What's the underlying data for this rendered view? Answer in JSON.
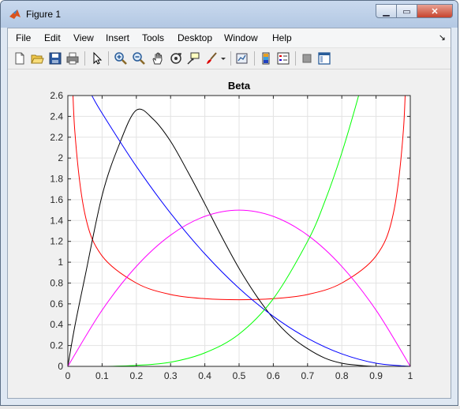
{
  "window": {
    "title": "Figure 1"
  },
  "menu": [
    "File",
    "Edit",
    "View",
    "Insert",
    "Tools",
    "Desktop",
    "Window",
    "Help"
  ],
  "toolbar_icons": [
    "new-figure-icon",
    "open-file-icon",
    "save-icon",
    "print-icon",
    "edit-plot-arrow-icon",
    "zoom-in-icon",
    "zoom-out-icon",
    "pan-hand-icon",
    "rotate-3d-icon",
    "data-cursor-icon",
    "brush-icon",
    "brush-dropdown-icon",
    "link-plot-icon",
    "insert-colorbar-icon",
    "insert-legend-icon",
    "hide-plot-tools-icon",
    "show-plot-tools-icon"
  ],
  "colors": {
    "red": "#ff0000",
    "black": "#000000",
    "blue": "#0000ff",
    "magenta": "#ff00ff",
    "green": "#00ff00"
  },
  "chart_data": {
    "type": "line",
    "title": "Beta",
    "xlabel": "",
    "ylabel": "",
    "xlim": [
      0,
      1
    ],
    "ylim": [
      0,
      2.6
    ],
    "grid": true,
    "xticks": [
      0,
      0.1,
      0.2,
      0.3,
      0.4,
      0.5,
      0.6,
      0.7,
      0.8,
      0.9,
      1
    ],
    "xtick_labels": [
      "0",
      "0.1",
      "0.2",
      "0.3",
      "0.4",
      "0.5",
      "0.6",
      "0.7",
      "0.8",
      "0.9",
      "1"
    ],
    "yticks": [
      0,
      0.2,
      0.4,
      0.6,
      0.8,
      1,
      1.2,
      1.4,
      1.6,
      1.8,
      2,
      2.2,
      2.4,
      2.6
    ],
    "ytick_labels": [
      "0",
      "0.2",
      "0.4",
      "0.6",
      "0.8",
      "1",
      "1.2",
      "1.4",
      "1.6",
      "1.8",
      "2",
      "2.2",
      "2.4",
      "2.6"
    ],
    "series": [
      {
        "color": "red",
        "x": [
          0.01,
          0.02,
          0.05,
          0.1,
          0.2,
          0.3,
          0.4,
          0.5,
          0.6,
          0.7,
          0.8,
          0.9,
          0.95,
          0.98,
          0.99
        ],
        "y": [
          3.2,
          2.27,
          1.46,
          1.06,
          0.8,
          0.69,
          0.65,
          0.64,
          0.65,
          0.69,
          0.8,
          1.06,
          1.46,
          2.27,
          3.2
        ]
      },
      {
        "color": "black",
        "x": [
          0,
          0.02,
          0.05,
          0.1,
          0.15,
          0.2,
          0.25,
          0.3,
          0.35,
          0.4,
          0.45,
          0.5,
          0.55,
          0.6,
          0.65,
          0.7,
          0.75,
          0.8,
          0.85,
          0.9,
          0.95,
          1
        ],
        "y": [
          0,
          0.38,
          0.86,
          1.64,
          2.13,
          2.46,
          2.37,
          2.16,
          1.87,
          1.56,
          1.24,
          0.94,
          0.68,
          0.46,
          0.29,
          0.17,
          0.08,
          0.03,
          0.01,
          0.0,
          0.0,
          0
        ]
      },
      {
        "color": "blue",
        "x": [
          0.07,
          0.1,
          0.2,
          0.3,
          0.4,
          0.5,
          0.6,
          0.7,
          0.8,
          0.9,
          1
        ],
        "y": [
          2.6,
          2.43,
          1.92,
          1.47,
          1.08,
          0.75,
          0.48,
          0.27,
          0.12,
          0.03,
          0
        ]
      },
      {
        "color": "magenta",
        "x": [
          0,
          0.1,
          0.2,
          0.3,
          0.4,
          0.5,
          0.6,
          0.7,
          0.8,
          0.9,
          1
        ],
        "y": [
          0,
          0.54,
          0.96,
          1.26,
          1.44,
          1.5,
          1.44,
          1.26,
          0.96,
          0.54,
          0
        ]
      },
      {
        "color": "green",
        "x": [
          0,
          0.1,
          0.2,
          0.3,
          0.4,
          0.5,
          0.6,
          0.7,
          0.75,
          0.8,
          0.85,
          0.89
        ],
        "y": [
          0,
          0.0,
          0.01,
          0.04,
          0.13,
          0.31,
          0.65,
          1.2,
          1.58,
          2.05,
          2.61,
          3.12
        ]
      }
    ]
  }
}
